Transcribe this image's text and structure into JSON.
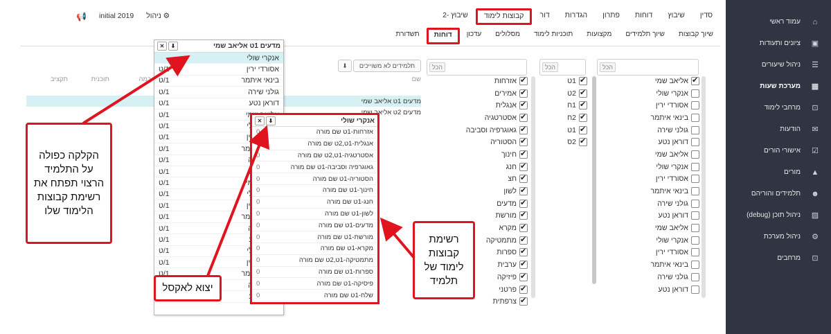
{
  "sidebar": {
    "items": [
      {
        "label": "עמוד ראשי",
        "icon": "home-icon",
        "glyph": "⌂"
      },
      {
        "label": "ציונים ותעודות",
        "icon": "certificate-icon",
        "glyph": "▣"
      },
      {
        "label": "ניהול שיעורים",
        "icon": "list-icon",
        "glyph": "☰"
      },
      {
        "label": "מערכת שעות",
        "icon": "calendar-icon",
        "glyph": "▦"
      },
      {
        "label": "מרחבי לימוד",
        "icon": "cart-icon",
        "glyph": "⊡"
      },
      {
        "label": "הודעות",
        "icon": "mail-icon",
        "glyph": "✉"
      },
      {
        "label": "אישורי הורים",
        "icon": "user-check-icon",
        "glyph": "☑"
      },
      {
        "label": "מורים",
        "icon": "graduation-icon",
        "glyph": "▲"
      },
      {
        "label": "תלמידים והוריהם",
        "icon": "family-icon",
        "glyph": "☻"
      },
      {
        "label": "ניהול תוכן (debug)",
        "icon": "image-icon",
        "glyph": "▨"
      },
      {
        "label": "ניהול מערכת",
        "icon": "admin-icon",
        "glyph": "⚙"
      },
      {
        "label": "מרחבים",
        "icon": "cart-icon",
        "glyph": "⊡"
      }
    ]
  },
  "topnav": [
    "סדין",
    "שיבוץ",
    "דוחות",
    "פתרון",
    "הגדרות",
    "דור",
    "קבוצות לימוד",
    "שיבוץ -2"
  ],
  "topnav_highlight": "קבוצות לימוד",
  "subnav": [
    "שיוך קבוצות",
    "שיוך תלמידים",
    "מקצועות",
    "תוכניות לימוד",
    "מסלולים",
    "עדכון",
    "דוחות",
    "תשדורת"
  ],
  "subnav_highlight": "דוחות",
  "topleft": {
    "manage": "ניהול",
    "year": "initial 2019"
  },
  "search_label": "הכל",
  "students_col": [
    "אליאב שמי",
    "אנקרי שולי",
    "אסורדי ירין",
    "בינאי איתמר",
    "גולני שירה",
    "דוראן נטע",
    "אליאב שמי",
    "אנקרי שולי",
    "אסורדי ירין",
    "בינאי איתמר",
    "גולני שירה",
    "דוראן נטע",
    "אליאב שמי",
    "אנקרי שולי",
    "אסורדי ירין",
    "בינאי איתמר",
    "גולני שירה",
    "דוראן נטע"
  ],
  "classes_col": [
    "1ט",
    "2ט",
    "1ח",
    "2ח",
    "1ט",
    "2ס"
  ],
  "subjects_col": [
    "אזרחות",
    "אמירים",
    "אנגלית",
    "אסטרטגיה",
    "גאוגרפיה וסביבה",
    "הסטוריה",
    "חינוך",
    "חנג",
    "חצ",
    "לשון",
    "מדעים",
    "מורשת",
    "מקרא",
    "מתמטיקה",
    "ספרות",
    "ערבית",
    "פיזיקה",
    "פרטני",
    "צרפתית"
  ],
  "unassigned_button": "תלמידים לא משוייכים",
  "bgtable": {
    "headers": [
      "שם",
      "",
      "",
      "",
      "",
      "",
      "כמה",
      "תוכנית",
      "תקציב"
    ],
    "rows": [
      {
        "name": "מדעים 1ט  אליאב שמי",
        "sel": true
      },
      {
        "name": "מדעים 2ט  אליאב שמי",
        "sel": false
      }
    ]
  },
  "student_popup": {
    "title": "מדעים 1ט   אליאב שמי",
    "rows": [
      {
        "name": "אנקרי שולי",
        "cls": ""
      },
      {
        "name": "אסורדי ירין",
        "cls": "1/ט"
      },
      {
        "name": "בינאי איתמר",
        "cls": "1/ט"
      },
      {
        "name": "גולני שירה",
        "cls": "1/ט"
      },
      {
        "name": "דוראן נטע",
        "cls": "1/ט"
      },
      {
        "name": "אליאב שמי",
        "cls": "1/ט"
      },
      {
        "name": "אנקרי שולי",
        "cls": "1/ט"
      },
      {
        "name": "אסורדי ירין",
        "cls": "1/ט"
      },
      {
        "name": "בינאי איתמר",
        "cls": "1/ט"
      },
      {
        "name": "גולני שירה",
        "cls": "1/ט"
      },
      {
        "name": "דוראן נטע",
        "cls": "1/ט"
      },
      {
        "name": "אליאב שמי",
        "cls": "1/ט"
      },
      {
        "name": "אנקרי שולי",
        "cls": "1/ט"
      },
      {
        "name": "אסורדי ירין",
        "cls": "1/ט"
      },
      {
        "name": "בינאי איתמר",
        "cls": "1/ט"
      },
      {
        "name": "גולני שירה",
        "cls": "1/ט"
      },
      {
        "name": "דוראן נטע",
        "cls": "1/ט"
      },
      {
        "name": "אנקרי שולי",
        "cls": "1/ט"
      },
      {
        "name": "אסורדי ירין",
        "cls": "1/ט"
      },
      {
        "name": "בינאי איתמר",
        "cls": "1/ט"
      },
      {
        "name": "גולני שירה",
        "cls": "1/ט"
      },
      {
        "name": "דוראן נטע",
        "cls": "1/ט"
      }
    ]
  },
  "group_popup": {
    "title": "אנקרי שולי",
    "rows": [
      {
        "label": "אזרחות-1ט  שם מורה",
        "count": "0"
      },
      {
        "label": "אנגלית-1ט,2ט  שם מורה",
        "count": "0"
      },
      {
        "label": "אסטרטגיה-1ט,2ט  שם מורה",
        "count": "0"
      },
      {
        "label": "גאוגרפיה וסביבה-1ט  שם מורה",
        "count": "0"
      },
      {
        "label": "הסטוריה-1ט  שם מורה",
        "count": "0"
      },
      {
        "label": "חינוך-1ט  שם מורה",
        "count": "0"
      },
      {
        "label": "חנג-1ט  שם מורה",
        "count": "0"
      },
      {
        "label": "לשון-1ט  שם מורה",
        "count": "0"
      },
      {
        "label": "מדעים-1ט  שם מורה",
        "count": "0"
      },
      {
        "label": "מורשת-1ט  שם מורה",
        "count": "0"
      },
      {
        "label": "מקרא-1ט  שם מורה",
        "count": "0"
      },
      {
        "label": "מתמטיקה-1ט,2ט  שם מורה",
        "count": "0"
      },
      {
        "label": "ספרות-1ט  שם מורה",
        "count": "0"
      },
      {
        "label": "פיסיקה-1ט  שם מורה",
        "count": "0"
      },
      {
        "label": "שלח-1ט  שם מורה",
        "count": "0"
      }
    ]
  },
  "callouts": {
    "dblclick": "הקלקה כפולה על התלמיד הרצוי תפתח את רשימת קבוצות הלימוד שלו",
    "grouplist": "רשימת קבוצות לימוד של תלמיד",
    "excel": "יצוא לאקסל"
  },
  "colors": {
    "accent": "#e0141e",
    "sidebar": "#2f3542",
    "selected": "#d6f1f4"
  }
}
